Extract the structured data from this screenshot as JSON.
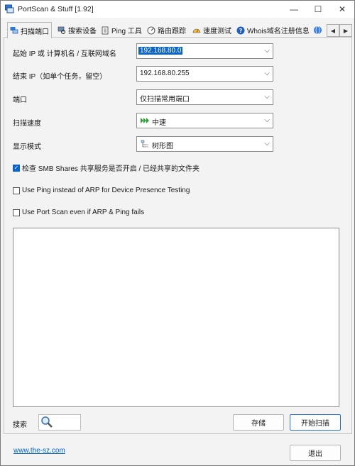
{
  "window": {
    "title": "PortScan & Stuff [1.92]",
    "minimize": "—",
    "maximize": "☐",
    "close": "✕"
  },
  "tabs": [
    {
      "label": "扫描端口",
      "icon": "network-scan-icon"
    },
    {
      "label": "搜索设备",
      "icon": "search-devices-icon"
    },
    {
      "label": "Ping 工具",
      "icon": "ping-tool-icon"
    },
    {
      "label": "路由跟踪",
      "icon": "traceroute-icon"
    },
    {
      "label": "速度测试",
      "icon": "speedometer-icon"
    },
    {
      "label": "Whois域名注册信息",
      "icon": "question-icon"
    }
  ],
  "form": {
    "start_ip": {
      "label": "起始 IP 或 计算机名 / 互联网域名",
      "value": "192.168.80.0"
    },
    "end_ip": {
      "label": "结束 IP（如单个任务，留空）",
      "value": "192.168.80.255"
    },
    "ports": {
      "label": "端口",
      "value": "仅扫描常用端口"
    },
    "speed": {
      "label": "扫描速度",
      "value": "中速"
    },
    "display": {
      "label": "显示模式",
      "value": "树形图"
    }
  },
  "options": [
    {
      "label": "检查 SMB Shares 共享服务是否开启 / 已经共享的文件夹",
      "checked": true
    },
    {
      "label": "Use Ping instead of ARP for Device Presence Testing",
      "checked": false
    },
    {
      "label": "Use Port Scan even if ARP & Ping fails",
      "checked": false
    }
  ],
  "bottom": {
    "search_label": "搜索",
    "save_button": "存储",
    "start_button": "开始扫描",
    "website": "www.the-sz.com",
    "exit_button": "退出"
  },
  "colors": {
    "accent": "#0a64c8",
    "link": "#0063c6",
    "speed_arrows": "#2e9e3a"
  }
}
